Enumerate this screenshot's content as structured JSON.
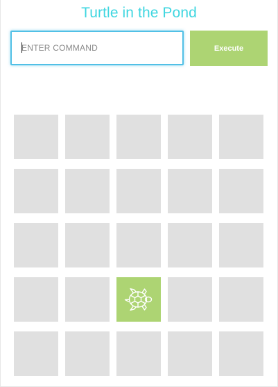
{
  "title": "Turtle in the Pond",
  "command": {
    "placeholder": "ENTER COMMAND",
    "value": ""
  },
  "execute_label": "Execute",
  "pond": {
    "rows": 5,
    "cols": 5,
    "turtle": {
      "row": 4,
      "col": 3
    },
    "colors": {
      "cell": "#e0e0e0",
      "turtle_cell": "#add473",
      "title": "#3fd6e0",
      "input_border": "#52c0e6",
      "button": "#add473"
    },
    "turtle_icon": "turtle-icon"
  }
}
